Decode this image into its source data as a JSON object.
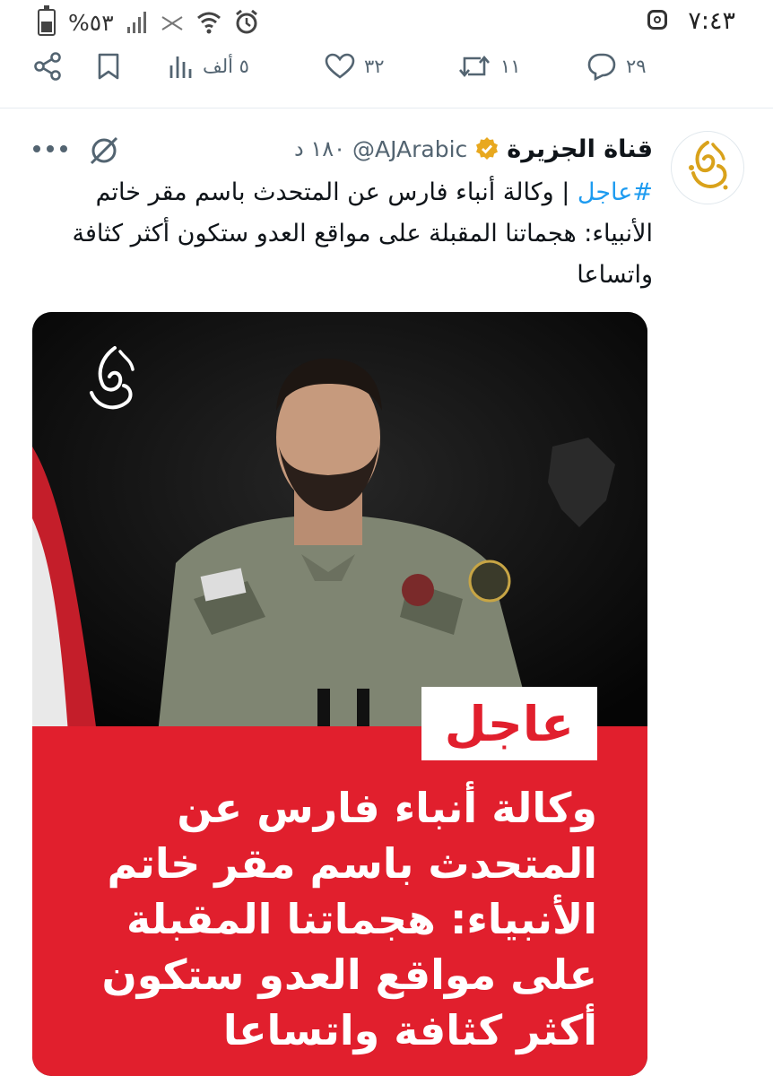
{
  "status_bar": {
    "time": "٧:٤٣",
    "battery": "%٥٣",
    "battery_level": 0.53,
    "icons": [
      "instagram-icon",
      "signal-icon",
      "vibrate-icon",
      "wifi-icon",
      "alarm-icon",
      "battery-icon"
    ]
  },
  "actions": {
    "replies": "٢٩",
    "retweets": "١١",
    "likes": "٣٢",
    "views": "٥ ألف"
  },
  "tweet": {
    "author_name": "قناة الجزيرة",
    "handle": "@AJArabic",
    "time": "١٨٠ د",
    "hashtag": "#عاجل",
    "text": " | وكالة أنباء فارس عن المتحدث باسم مقر خاتم الأنبياء: هجماتنا المقبلة على مواقع العدو ستكون أكثر كثافة واتساعا",
    "verified_color": "#e8a81e"
  },
  "media": {
    "badge": "عاجل",
    "headline": "وكالة أنباء فارس عن المتحدث باسم مقر خاتم الأنبياء: هجماتنا المقبلة على مواقع العدو ستكون أكثر كثافة واتساعا",
    "accent_color": "#e11f2d"
  }
}
